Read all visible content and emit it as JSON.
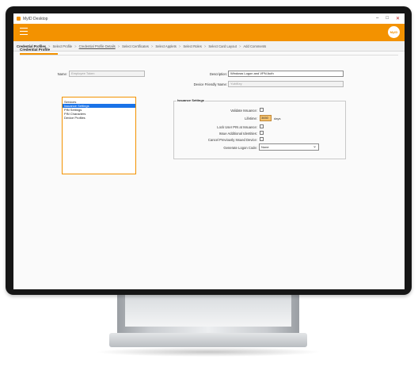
{
  "window": {
    "title": "MyID Desktop",
    "controls": {
      "minimize": "–",
      "maximize": "□",
      "close": "✕"
    }
  },
  "header": {
    "logo_text": "MyID",
    "menu_icon": "hamburger-icon"
  },
  "breadcrumb": [
    "Credential Profiles",
    "Select Profile",
    "Credential Profile Details",
    "Select Certificates",
    "Select Applets",
    "Select Roles",
    "Select Card Layout",
    "Add Comments"
  ],
  "breadcrumb_separator": ">",
  "tabs": {
    "active": "Credential Profile"
  },
  "form": {
    "name_label": "Name:",
    "name_value": "Employee Token",
    "description_label": "Description:",
    "description_value": "Windows Logon and VPN Auth",
    "device_name_label": "Device Friendly Name:",
    "device_name_value": "YubiKey"
  },
  "sections": {
    "items": [
      "Services",
      "Issuance Settings",
      "PIN Settings",
      "PIN Characters",
      "Device Profiles"
    ],
    "selected": "Issuance Settings"
  },
  "issuance": {
    "title": "Issuance Settings",
    "validate_label": "Validate Issuance:",
    "lifetime_label": "Lifetime:",
    "lifetime_value": "3650",
    "lifetime_unit": "days",
    "lock_pin_label": "Lock User PIN at Issuance:",
    "issue_additional_label": "Issue Additional Identities:",
    "cancel_previous_label": "Cancel Previously Issued Device:",
    "logon_code_label": "Generate Logon Code:",
    "logon_code_value": "None"
  },
  "colors": {
    "accent": "#f39200",
    "selection": "#1a73e8",
    "bezel": "#161616"
  }
}
